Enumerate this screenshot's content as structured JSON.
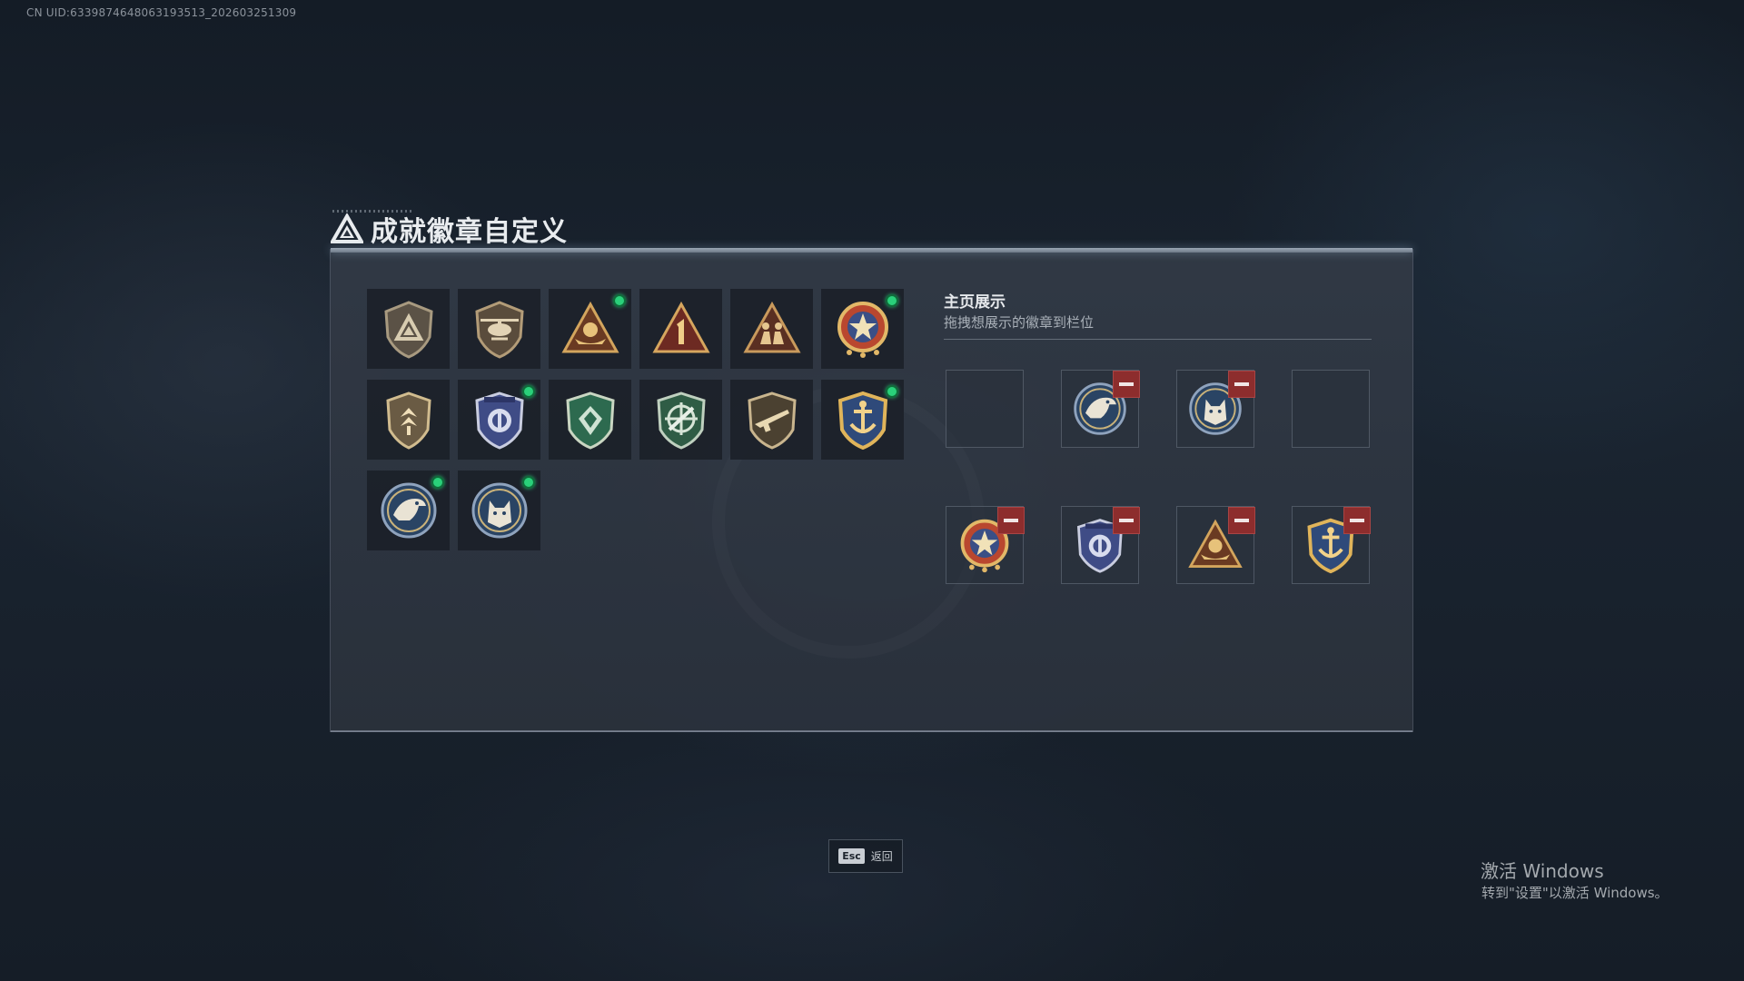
{
  "uid_text": "CN UID:6339874648063193513_202603251309",
  "title": "成就徽章自定义",
  "badges": [
    {
      "icon": "shield-triangle-icon",
      "has_new": false
    },
    {
      "icon": "helicopter-shield-icon",
      "has_new": false
    },
    {
      "icon": "pyramid-boat-icon",
      "has_new": true
    },
    {
      "icon": "number-one-triangle-icon",
      "has_new": false
    },
    {
      "icon": "soldiers-triangle-icon",
      "has_new": false
    },
    {
      "icon": "star-medal-icon",
      "has_new": true
    },
    {
      "icon": "rank-shield-icon",
      "has_new": false
    },
    {
      "icon": "police-shield-icon",
      "has_new": true
    },
    {
      "icon": "green-gem-shield-icon",
      "has_new": false
    },
    {
      "icon": "green-crosshair-shield-icon",
      "has_new": false
    },
    {
      "icon": "rifle-shield-icon",
      "has_new": false
    },
    {
      "icon": "gold-anchor-shield-icon",
      "has_new": true
    },
    {
      "icon": "eagle-round-icon",
      "has_new": true
    },
    {
      "icon": "wolf-round-icon",
      "has_new": true
    }
  ],
  "showcase": {
    "title": "主页展示",
    "subtitle": "拖拽想展示的徽章到栏位",
    "slots": [
      {
        "icon": null
      },
      {
        "icon": "eagle-round-icon"
      },
      {
        "icon": "wolf-round-icon"
      },
      {
        "icon": null
      },
      {
        "icon": "star-medal-icon"
      },
      {
        "icon": "police-shield-icon"
      },
      {
        "icon": "pyramid-boat-icon"
      },
      {
        "icon": "gold-anchor-shield-icon"
      }
    ]
  },
  "footer": {
    "esc_key": "Esc",
    "back_label": "返回"
  },
  "windows_watermark": {
    "title": "激活 Windows",
    "subtitle": "转到\"设置\"以激活 Windows。"
  },
  "colors": {
    "new_dot": "#2ad07a",
    "remove_button": "#8d2d2d",
    "panel": "#323a46"
  }
}
